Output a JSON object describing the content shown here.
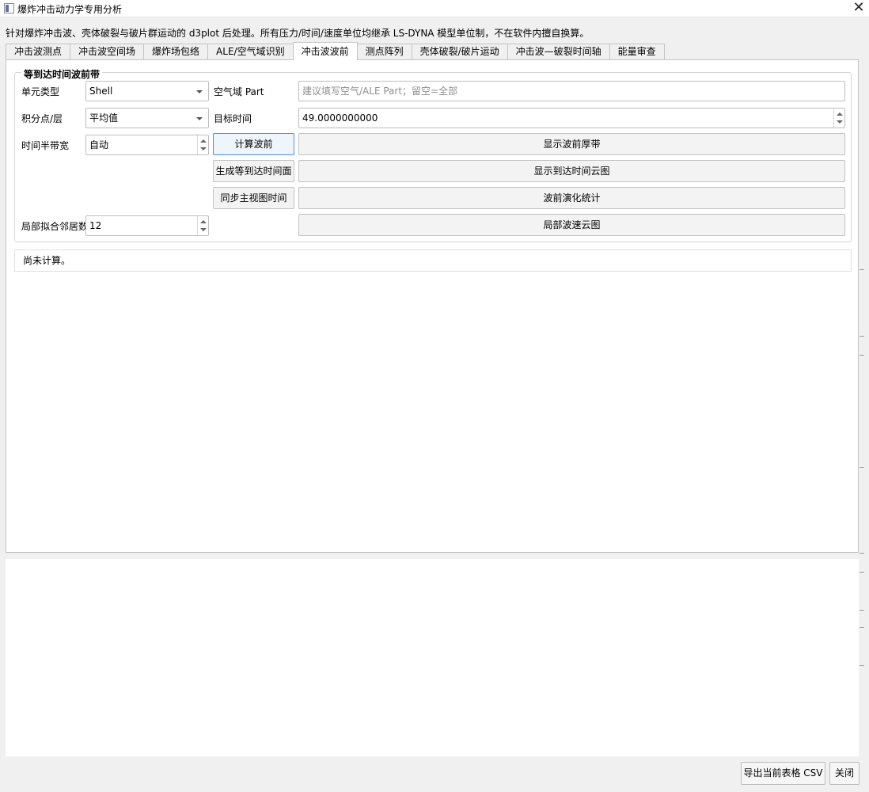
{
  "window": {
    "title": "爆炸冲击动力学专用分析",
    "close_symbol": "✕"
  },
  "banner": "针对爆炸冲击波、壳体破裂与破片群运动的 d3plot 后处理。所有压力/时间/速度单位均继承 LS-DYNA 模型单位制，不在软件内擅自换算。",
  "tabs": [
    {
      "label": "冲击波测点"
    },
    {
      "label": "冲击波空间场"
    },
    {
      "label": "爆炸场包络"
    },
    {
      "label": "ALE/空气域识别"
    },
    {
      "label": "冲击波波前",
      "active": true
    },
    {
      "label": "测点阵列"
    },
    {
      "label": "壳体破裂/破片运动"
    },
    {
      "label": "冲击波—破裂时间轴"
    },
    {
      "label": "能量审查"
    }
  ],
  "group": {
    "title": "等到达时间波前带",
    "element_type": {
      "label": "单元类型",
      "value": "Shell"
    },
    "integration": {
      "label": "积分点/层",
      "value": "平均值"
    },
    "half_bandwidth": {
      "label": "时间半带宽",
      "value": "自动"
    },
    "neighbors": {
      "label": "局部拟合邻居数",
      "value": "12"
    },
    "air_part": {
      "label": "空气域 Part",
      "placeholder": "建议填写空气/ALE Part；留空=全部"
    },
    "target_time": {
      "label": "目标时间",
      "value": "49.0000000000"
    },
    "buttons": {
      "compute": "计算波前",
      "generate_surface": "生成等到达时间面",
      "sync_time": "同步主视图时间",
      "show_band": "显示波前厚带",
      "show_arrival": "显示到达时间云图",
      "evolution": "波前演化统计",
      "local_speed": "局部波速云图"
    }
  },
  "status": "尚未计算。",
  "footer": {
    "export": "导出当前表格 CSV",
    "close": "关闭"
  }
}
